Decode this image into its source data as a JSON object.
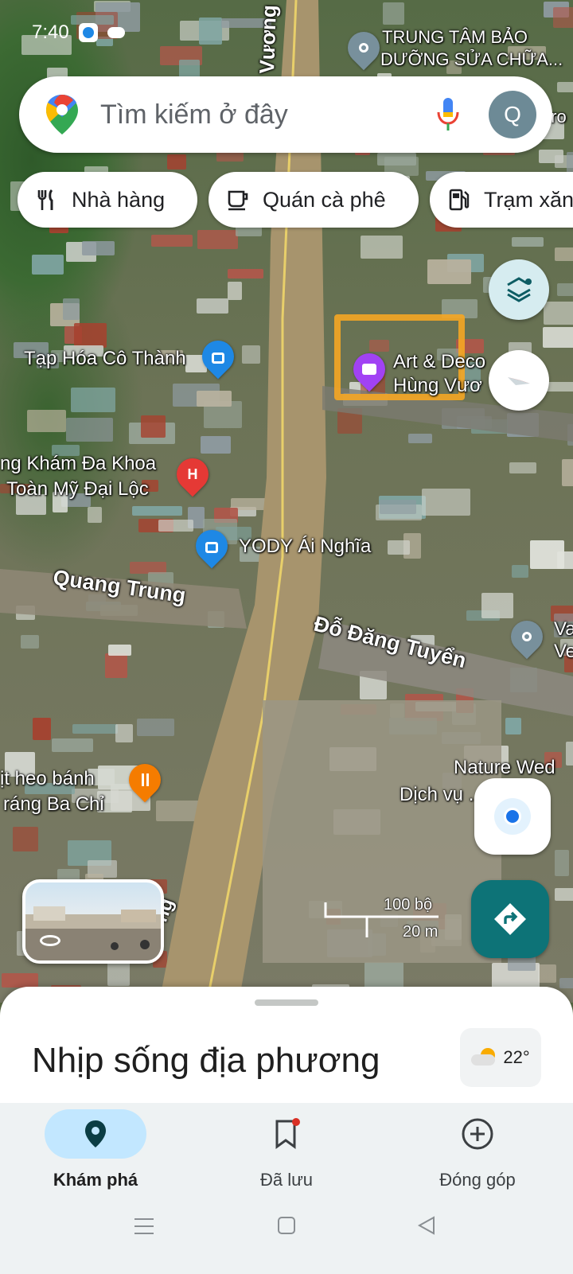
{
  "status_bar": {
    "time": "7:40"
  },
  "search": {
    "placeholder": "Tìm kiếm ở đây",
    "avatar_letter": "Q"
  },
  "chips": [
    {
      "label": "Nhà hàng",
      "icon": "fork-knife-icon"
    },
    {
      "label": "Quán cà phê",
      "icon": "coffee-cup-icon"
    },
    {
      "label": "Trạm xăng",
      "icon": "gas-station-icon"
    }
  ],
  "map": {
    "streets": {
      "vuong_top": "Vương",
      "quang_trung": "Quang Trung",
      "do_dang_tuyen": "Đỗ Đăng Tuyển",
      "vuong_bottom": "ng"
    },
    "pois": {
      "top_right_line1": "TRUNG TÂM BẢO",
      "top_right_line2": "DƯỠNG SỬA CHỮA...",
      "top_right_edge": "tro",
      "tap_hoa": "Tạp Hóa Cô Thành",
      "art_line1": "Art & Deco",
      "art_line2": "Hùng Vươ",
      "kham_line1": "ng Khám Đa Khoa",
      "kham_line2": "Toàn Mỹ Đại Lộc",
      "yody": "YODY Ái Nghĩa",
      "right_v1": "Va",
      "right_v2": "Ve",
      "thit_line1": "ịt heo bánh",
      "thit_line2": "ráng Ba Chỉ",
      "nature_line1": "Nature Wed",
      "nature_line2": "Dịch vụ ... ảnh"
    },
    "scale": {
      "feet": "100 bộ",
      "meters": "20 m"
    }
  },
  "sheet": {
    "title": "Nhịp sống địa phương",
    "weather_temp": "22°"
  },
  "bottom_nav": [
    {
      "label": "Khám phá",
      "icon": "location-pin-icon",
      "active": true
    },
    {
      "label": "Đã lưu",
      "icon": "bookmark-icon",
      "active": false
    },
    {
      "label": "Đóng góp",
      "icon": "add-circle-icon",
      "active": false
    }
  ],
  "colors": {
    "accent_teal": "#0d7377",
    "active_pill": "#c2e7ff",
    "orange_highlight": "#f5a623",
    "pin_blue": "#1e88e5",
    "pin_red": "#e53935",
    "pin_orange": "#f57c00",
    "pin_purple": "#a142f4"
  }
}
